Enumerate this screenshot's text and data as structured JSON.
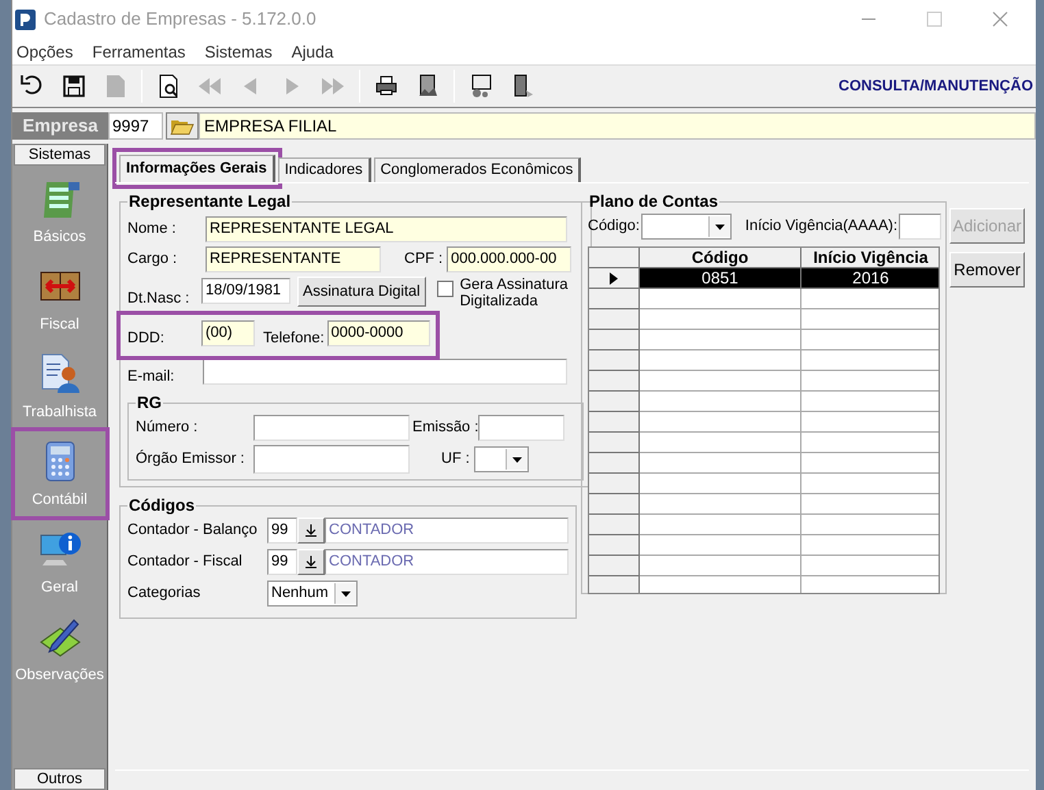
{
  "window": {
    "title": "Cadastro de Empresas - 5.172.0.0"
  },
  "menu": [
    "Opções",
    "Ferramentas",
    "Sistemas",
    "Ajuda"
  ],
  "toolbar": [
    {
      "kind": "undo",
      "disabled": false
    },
    {
      "kind": "save",
      "disabled": false
    },
    {
      "kind": "document",
      "disabled": true
    },
    {
      "kind": "separator"
    },
    {
      "kind": "preview",
      "disabled": false
    },
    {
      "kind": "first",
      "disabled": true
    },
    {
      "kind": "prev",
      "disabled": true
    },
    {
      "kind": "next",
      "disabled": true
    },
    {
      "kind": "last",
      "disabled": true
    },
    {
      "kind": "separator"
    },
    {
      "kind": "print",
      "disabled": false
    },
    {
      "kind": "tools",
      "disabled": false
    },
    {
      "kind": "separator"
    },
    {
      "kind": "notes",
      "disabled": false
    },
    {
      "kind": "exit",
      "disabled": false
    }
  ],
  "mode": "CONSULTA/MANUTENÇÃO",
  "empresa": {
    "label": "Empresa",
    "code": "9997",
    "name": "EMPRESA FILIAL"
  },
  "sidebar": {
    "header": "Sistemas",
    "footer": "Outros",
    "items": [
      {
        "label": "Básicos",
        "kind": "forms",
        "highlighted": false
      },
      {
        "label": "Fiscal",
        "kind": "book",
        "highlighted": false
      },
      {
        "label": "Trabalhista",
        "kind": "person",
        "highlighted": false
      },
      {
        "label": "Contábil",
        "kind": "calculator",
        "highlighted": true
      },
      {
        "label": "Geral",
        "kind": "info",
        "highlighted": false
      },
      {
        "label": "Observações",
        "kind": "pencil",
        "highlighted": false
      }
    ]
  },
  "tabs": [
    {
      "label": "Informações Gerais",
      "selected": true,
      "highlighted": true
    },
    {
      "label": "Indicadores",
      "selected": false,
      "highlighted": false
    },
    {
      "label": "Conglomerados Econômicos",
      "selected": false,
      "highlighted": false
    }
  ],
  "representante": {
    "title": "Representante Legal",
    "nome": {
      "label": "Nome :",
      "value": "REPRESENTANTE LEGAL"
    },
    "cargo": {
      "label": "Cargo :",
      "value": "REPRESENTANTE"
    },
    "cpf": {
      "label": "CPF :",
      "value": "000.000.000-00"
    },
    "nascimento": {
      "label": "Dt.Nasc :",
      "value": "18/09/1981"
    },
    "assinatura_button": "Assinatura Digital",
    "gera_assinatura": {
      "label": "Gera Assinatura Digitalizada",
      "checked": false
    },
    "contato_highlighted": true,
    "ddd": {
      "label": "DDD:",
      "value": "(00)"
    },
    "telefone": {
      "label": "Telefone:",
      "value": "0000-0000"
    },
    "email": {
      "label": "E-mail:"
    }
  },
  "rg": {
    "title": "RG",
    "numero_label": "Número :",
    "emissao_label": "Emissão :",
    "orgao_label": "Órgão Emissor :",
    "uf_label": "UF :"
  },
  "codigos": {
    "title": "Códigos",
    "contadores": [
      {
        "label": "Contador - Balanço",
        "code": "99",
        "name": "CONTADOR"
      },
      {
        "label": "Contador - Fiscal",
        "code": "99",
        "name": "CONTADOR"
      }
    ],
    "categorias": {
      "label": "Categorias",
      "value": "Nenhum"
    }
  },
  "plano_de_contas": {
    "title": "Plano de Contas",
    "codigo_label": "Código:",
    "inicio_label": "Início Vigência(AAAA):",
    "add_button": {
      "label": "Adicionar",
      "disabled": true
    },
    "remove_button": {
      "label": "Remover",
      "disabled": false
    },
    "columns": [
      "Código",
      "Início Vigência"
    ],
    "rows": [
      {
        "codigo": "0851",
        "inicio": "2016",
        "selected": true
      }
    ]
  }
}
